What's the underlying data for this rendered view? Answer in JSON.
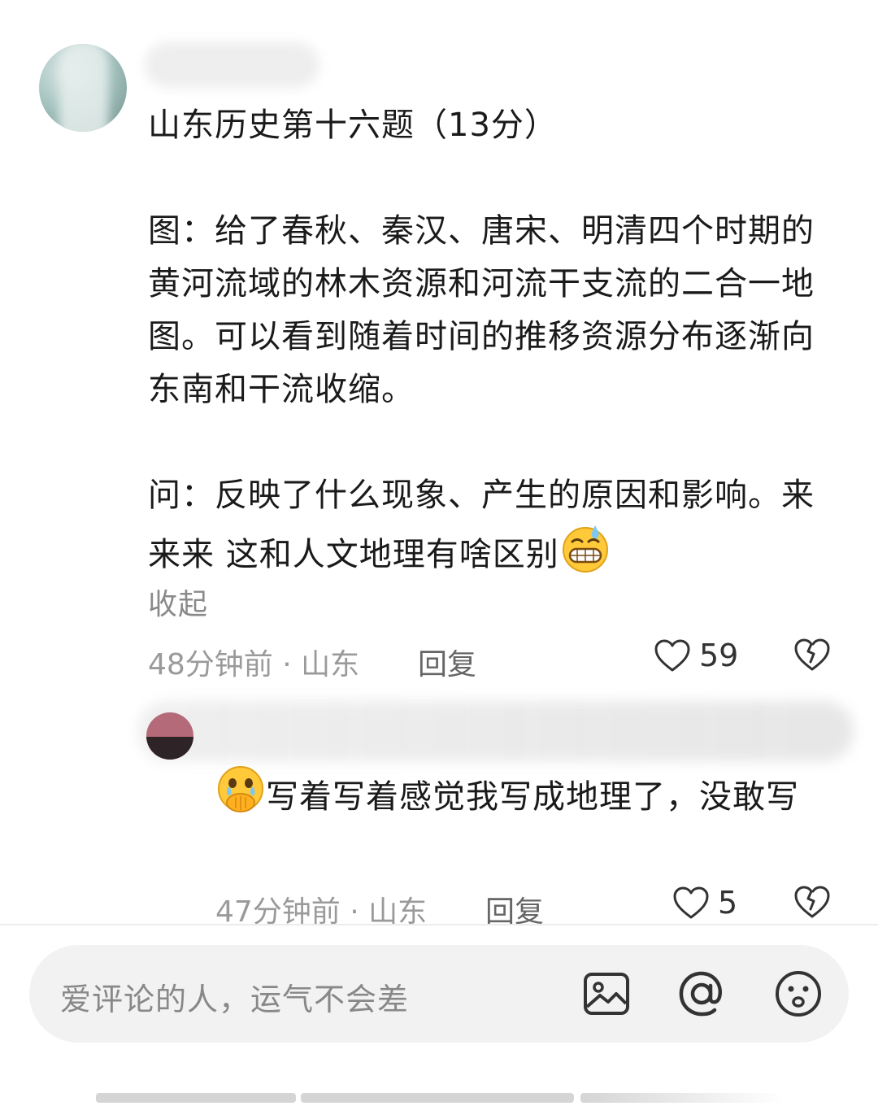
{
  "main_comment": {
    "paragraphs": [
      "山东历史第十六题（13分）",
      "图：给了春秋、秦汉、唐宋、明清四个时期的黄河流域的林木资源和河流干支流的二合一地图。可以看到随着时间的推移资源分布逐渐向东南和干流收缩。",
      "问：反映了什么现象、产生的原因和影响。来来来 这和人文地理有啥区别"
    ],
    "emoji": "grinning-sweat-emoji",
    "collapse_label": "收起",
    "time_location": "48分钟前 · 山东",
    "reply_label": "回复",
    "like_count": "59"
  },
  "reply_comment": {
    "emoji": "crying-hands-over-mouth-emoji",
    "text": "写着写着感觉我写成地理了，没敢写",
    "time_location": "47分钟前 · 山东",
    "reply_label": "回复",
    "like_count": "5"
  },
  "input_bar": {
    "placeholder": "爱评论的人，运气不会差",
    "icons": [
      "image-icon",
      "at-icon",
      "emoji-icon"
    ]
  },
  "colors": {
    "text": "#1a1a1a",
    "meta": "#9a9a9a",
    "input_bg": "#f2f2f2"
  }
}
